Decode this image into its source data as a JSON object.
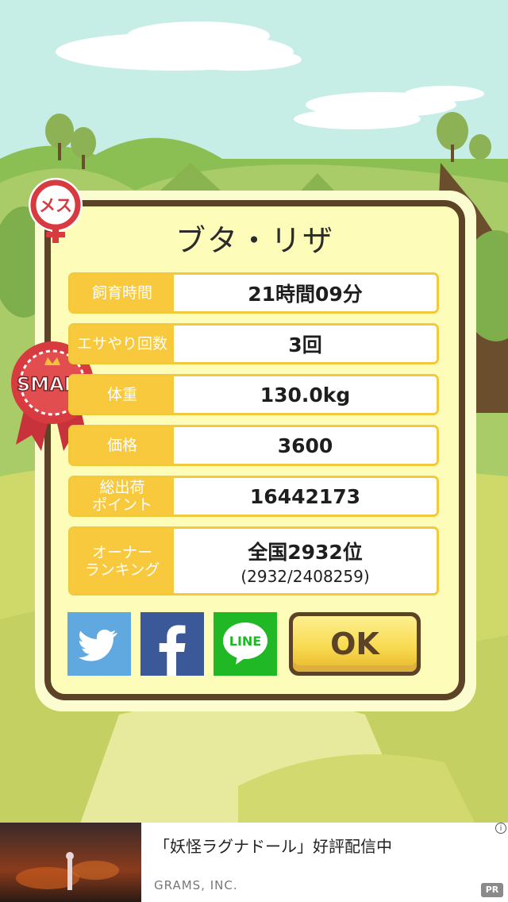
{
  "pig": {
    "name": "ブタ・リザ",
    "gender_badge": "メス",
    "size_ribbon": "SMALL"
  },
  "stats": [
    {
      "label": "飼育時間",
      "value": "21時間09分"
    },
    {
      "label": "エサやり回数",
      "value": "3回"
    },
    {
      "label": "体重",
      "value": "130.0kg"
    },
    {
      "label": "価格",
      "value": "3600"
    },
    {
      "label": "総出荷\nポイント",
      "value": "16442173"
    },
    {
      "label": "オーナー\nランキング",
      "value": "全国2932位",
      "sub": "(2932/2408259)"
    }
  ],
  "share": {
    "twitter": "twitter-icon",
    "facebook": "facebook-icon",
    "line_label": "LINE"
  },
  "ok_button": "OK",
  "ad": {
    "title": "「妖怪ラグナドール」好評配信中",
    "sponsor": "GRAMS, INC.",
    "badge": "PR",
    "info": "i"
  },
  "colors": {
    "sky": "#c7eee6",
    "card_border": "#5c4226",
    "label_bg": "#f8c93d",
    "twitter": "#5fa8e0",
    "facebook": "#3b5998",
    "line": "#20b925",
    "ribbon": "#d73a3f"
  }
}
